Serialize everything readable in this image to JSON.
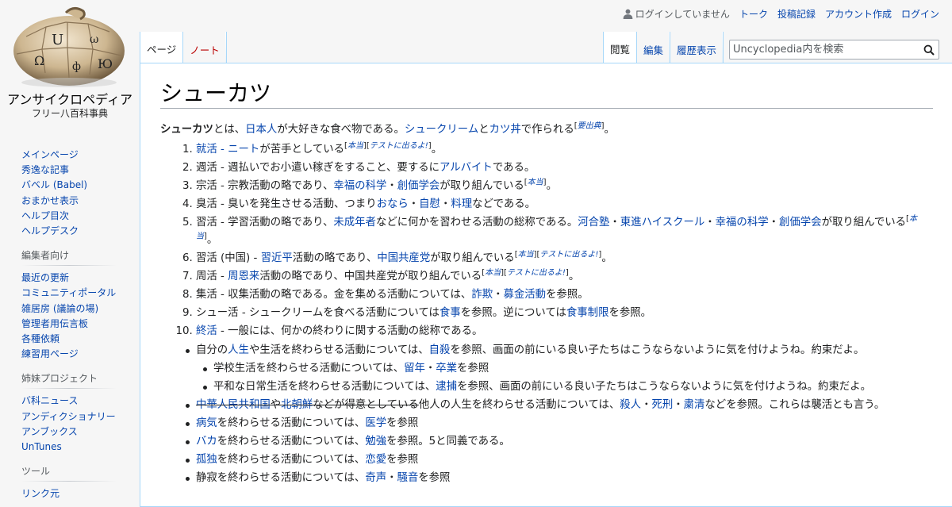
{
  "site": {
    "name": "アンサイクロペディア",
    "tagline": "フリー八百科事典"
  },
  "personal": {
    "anon": "ログインしていません",
    "links": [
      "トーク",
      "投稿記録",
      "アカウント作成",
      "ログイン"
    ]
  },
  "tabs": {
    "left": [
      "ページ",
      "ノート"
    ],
    "right": [
      "閲覧",
      "編集",
      "履歴表示"
    ]
  },
  "search": {
    "placeholder": "Uncyclopedia内を検索"
  },
  "sidebar": {
    "nav": [
      "メインページ",
      "秀逸な記事",
      "バベル (Babel)",
      "おまかせ表示",
      "ヘルプ目次",
      "ヘルプデスク"
    ],
    "edit": {
      "heading": "編集者向け",
      "items": [
        "最近の更新",
        "コミュニティポータル",
        "雑居房 (議論の場)",
        "管理者用伝言板",
        "各種依頼",
        "練習用ページ"
      ]
    },
    "sister": {
      "heading": "姉妹プロジェクト",
      "items": [
        "バ科ニュース",
        "アンディクショナリー",
        "アンブックス",
        "UnTunes"
      ]
    },
    "tools": {
      "heading": "ツール",
      "items": [
        "リンク元"
      ]
    }
  },
  "article": {
    "title": "シューカツ",
    "intro": {
      "bold": "シューカツ",
      "t1": "とは、",
      "l1": "日本人",
      "t2": "が大好きな食べ物である。",
      "l2": "シュークリーム",
      "t3": "と",
      "l3": "カツ丼",
      "t4": "で作られる",
      "sup_open": "[",
      "sup": "要出典",
      "sup_close": "]",
      "end": "。"
    },
    "items": {
      "i1": {
        "l1": "就活",
        "t1": " - ",
        "l2": "ニート",
        "t2": "が苦手としている",
        "s1": "本当",
        "s2": "テストに出るよ!",
        "end": "。"
      },
      "i2": {
        "t1": "週活 - 週払いでお小遣い稼ぎをすること、要するに",
        "l1": "アルバイト",
        "t2": "である。"
      },
      "i3": {
        "t1": "宗活 - 宗教活動の略であり、",
        "l1": "幸福の科学",
        "t2": "・",
        "l2": "創価学会",
        "t3": "が取り組んでいる",
        "s1": "本当",
        "end": "。"
      },
      "i4": {
        "t1": "臭活 - 臭いを発生させる活動、つまり",
        "l1": "おなら",
        "t2": "・",
        "l2": "自慰",
        "t3": "・",
        "l3": "料理",
        "t4": "などである。"
      },
      "i5": {
        "t1": "習活 - 学習活動の略であり、",
        "l1": "未成年者",
        "t2": "などに何かを習わせる活動の総称である。",
        "l2": "河合塾",
        "t3": "・",
        "l3": "東進ハイスクール",
        "t4": "・",
        "l4": "幸福の科学",
        "t5": "・",
        "l5": "創価学会",
        "t6": "が取り組んでいる",
        "s1": "本当",
        "end": "。"
      },
      "i6": {
        "t1": "習活 (中国) - ",
        "l1": "習近平",
        "t2": "活動の略であり、",
        "l2": "中国共産党",
        "t3": "が取り組んでいる",
        "s1": "本当",
        "s2": "テストに出るよ!",
        "end": "。"
      },
      "i7": {
        "t1": "周活 - ",
        "l1": "周恩来",
        "t2": "活動の略であり、中国共産党が取り組んでいる",
        "s1": "本当",
        "s2": "テストに出るよ!",
        "end": "。"
      },
      "i8": {
        "t1": "集活 - 収集活動の略である。金を集める活動については、",
        "l1": "詐欺",
        "t2": "・",
        "l2": "募金活動",
        "t3": "を参照。"
      },
      "i9": {
        "t1": "シュー活 - シュークリームを食べる活動については",
        "l1": "食事",
        "t2": "を参照。逆については",
        "l2": "食事制限",
        "t3": "を参照。"
      },
      "i10": {
        "l1": "終活",
        "t1": " - 一般には、何かの終わりに関する活動の総称である。"
      }
    },
    "bullets": {
      "b1": {
        "t1": "自分の",
        "l1": "人生",
        "t2": "や生活を終わらせる活動については、",
        "l2": "自殺",
        "t3": "を参照、画面の前にいる良い子たちはこうならないように気を付けようね。約束だよ。"
      },
      "b1a": {
        "t1": "学校生活を終わらせる活動については、",
        "l1": "留年",
        "t2": "・",
        "l2": "卒業",
        "t3": "を参照"
      },
      "b1b": {
        "t1": "平和な日常生活を終わらせる活動については、",
        "l1": "逮捕",
        "t2": "を参照、画面の前にいる良い子たちはこうならないように気を付けようね。約束だよ。"
      },
      "b2": {
        "l1": "中華人民共和国",
        "s1": "や",
        "l2": "北朝鮮",
        "s2": "などが得意としている",
        "t1": "他人の人生を終わらせる活動については、",
        "l3": "殺人",
        "t2": "・",
        "l4": "死刑",
        "t3": "・",
        "l5": "粛清",
        "t4": "などを参照。これらは襲活とも言う。"
      },
      "b3": {
        "l1": "病気",
        "t1": "を終わらせる活動については、",
        "l2": "医学",
        "t2": "を参照"
      },
      "b4": {
        "l1": "バカ",
        "t1": "を終わらせる活動については、",
        "l2": "勉強",
        "t2": "を参照。5と同義である。"
      },
      "b5": {
        "l1": "孤独",
        "t1": "を終わらせる活動については、",
        "l2": "恋愛",
        "t2": "を参照"
      },
      "b6": {
        "t1": "静寂を終わらせる活動については、",
        "l1": "奇声",
        "t2": "・",
        "l2": "騒音",
        "t3": "を参照"
      }
    }
  }
}
